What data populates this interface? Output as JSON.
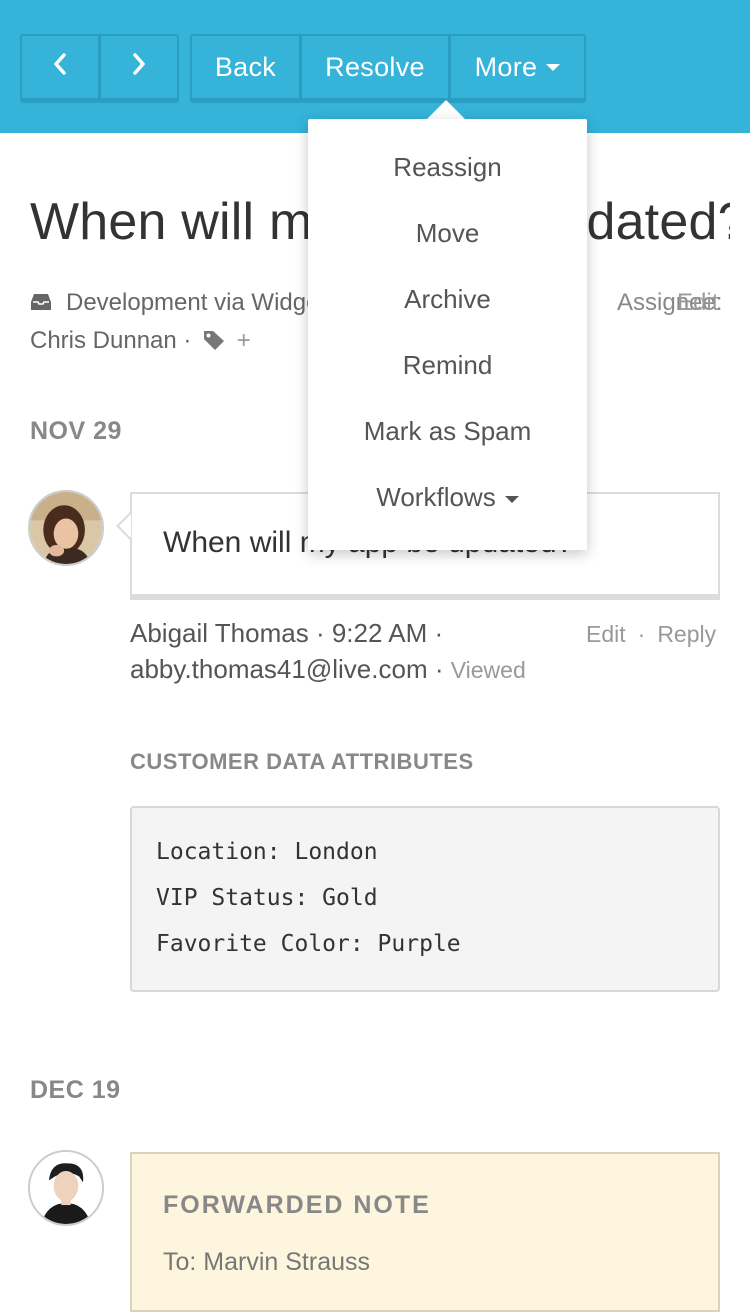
{
  "toolbar": {
    "prev_icon": "chevron-left-icon",
    "next_icon": "chevron-right-icon",
    "back_label": "Back",
    "resolve_label": "Resolve",
    "more_label": "More",
    "bar_color": "#35b3d9"
  },
  "conversation": {
    "title": "When will my app be updated?",
    "mailbox": "Development via Widget",
    "assignee_label": "Assignee:",
    "assignee_edit": "Edit",
    "customer_name": "Chris Dunnan",
    "separator": "·",
    "tag_icon": "tag-icon",
    "tag_add": "+"
  },
  "thread": [
    {
      "date": "NOV 29",
      "message": "When will my app be updated?",
      "author": "Abigail Thomas · 9:22 AM ·",
      "email": "abby.thomas41@live.com ·",
      "status": "Viewed",
      "edit_label": "Edit",
      "reply_label": "Reply"
    }
  ],
  "customer_data": {
    "heading": "CUSTOMER DATA ATTRIBUTES",
    "lines": [
      "Location: London",
      "VIP Status: Gold",
      "Favorite Color: Purple"
    ]
  },
  "forwarded": {
    "date": "DEC 19",
    "title": "FORWARDED NOTE",
    "to": "To: Marvin Strauss",
    "bg_color": "#fdf5dd"
  },
  "more_menu": {
    "items": [
      "Reassign",
      "Move",
      "Archive",
      "Remind",
      "Mark as Spam",
      "Workflows"
    ]
  }
}
